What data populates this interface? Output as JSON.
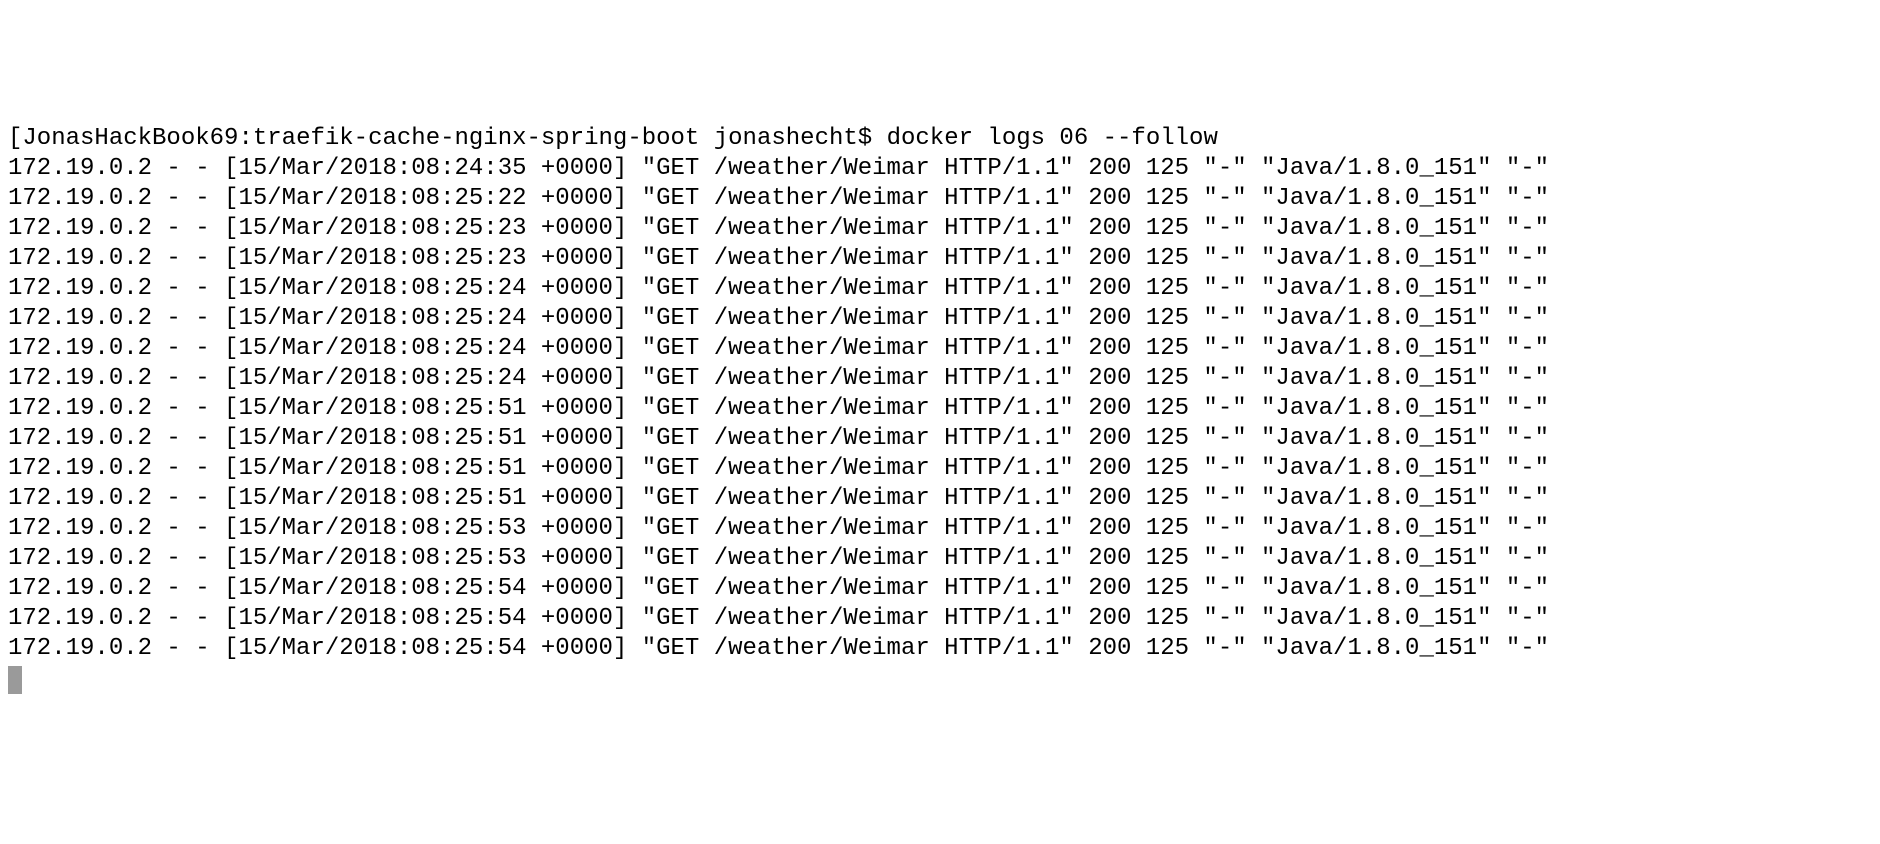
{
  "prompt": {
    "open_bracket": "[",
    "host": "JonasHackBook69",
    "sep1": ":",
    "path": "traefik-cache-nginx-spring-boot",
    "space": " ",
    "user": "jonashecht",
    "dollar": "$ ",
    "command": "docker logs 06 --follow"
  },
  "log_entries": [
    {
      "ip": "172.19.0.2",
      "dash1": " - - ",
      "ts": "[15/Mar/2018:08:24:35 +0000]",
      "req": " \"GET /weather/Weimar HTTP/1.1\" ",
      "status": "200",
      "size": " 125 ",
      "ref": "\"-\" ",
      "ua": "\"Java/1.8.0_151\" ",
      "tail": "\"-\""
    },
    {
      "ip": "172.19.0.2",
      "dash1": " - - ",
      "ts": "[15/Mar/2018:08:25:22 +0000]",
      "req": " \"GET /weather/Weimar HTTP/1.1\" ",
      "status": "200",
      "size": " 125 ",
      "ref": "\"-\" ",
      "ua": "\"Java/1.8.0_151\" ",
      "tail": "\"-\""
    },
    {
      "ip": "172.19.0.2",
      "dash1": " - - ",
      "ts": "[15/Mar/2018:08:25:23 +0000]",
      "req": " \"GET /weather/Weimar HTTP/1.1\" ",
      "status": "200",
      "size": " 125 ",
      "ref": "\"-\" ",
      "ua": "\"Java/1.8.0_151\" ",
      "tail": "\"-\""
    },
    {
      "ip": "172.19.0.2",
      "dash1": " - - ",
      "ts": "[15/Mar/2018:08:25:23 +0000]",
      "req": " \"GET /weather/Weimar HTTP/1.1\" ",
      "status": "200",
      "size": " 125 ",
      "ref": "\"-\" ",
      "ua": "\"Java/1.8.0_151\" ",
      "tail": "\"-\""
    },
    {
      "ip": "172.19.0.2",
      "dash1": " - - ",
      "ts": "[15/Mar/2018:08:25:24 +0000]",
      "req": " \"GET /weather/Weimar HTTP/1.1\" ",
      "status": "200",
      "size": " 125 ",
      "ref": "\"-\" ",
      "ua": "\"Java/1.8.0_151\" ",
      "tail": "\"-\""
    },
    {
      "ip": "172.19.0.2",
      "dash1": " - - ",
      "ts": "[15/Mar/2018:08:25:24 +0000]",
      "req": " \"GET /weather/Weimar HTTP/1.1\" ",
      "status": "200",
      "size": " 125 ",
      "ref": "\"-\" ",
      "ua": "\"Java/1.8.0_151\" ",
      "tail": "\"-\""
    },
    {
      "ip": "172.19.0.2",
      "dash1": " - - ",
      "ts": "[15/Mar/2018:08:25:24 +0000]",
      "req": " \"GET /weather/Weimar HTTP/1.1\" ",
      "status": "200",
      "size": " 125 ",
      "ref": "\"-\" ",
      "ua": "\"Java/1.8.0_151\" ",
      "tail": "\"-\""
    },
    {
      "ip": "172.19.0.2",
      "dash1": " - - ",
      "ts": "[15/Mar/2018:08:25:24 +0000]",
      "req": " \"GET /weather/Weimar HTTP/1.1\" ",
      "status": "200",
      "size": " 125 ",
      "ref": "\"-\" ",
      "ua": "\"Java/1.8.0_151\" ",
      "tail": "\"-\""
    },
    {
      "ip": "172.19.0.2",
      "dash1": " - - ",
      "ts": "[15/Mar/2018:08:25:51 +0000]",
      "req": " \"GET /weather/Weimar HTTP/1.1\" ",
      "status": "200",
      "size": " 125 ",
      "ref": "\"-\" ",
      "ua": "\"Java/1.8.0_151\" ",
      "tail": "\"-\""
    },
    {
      "ip": "172.19.0.2",
      "dash1": " - - ",
      "ts": "[15/Mar/2018:08:25:51 +0000]",
      "req": " \"GET /weather/Weimar HTTP/1.1\" ",
      "status": "200",
      "size": " 125 ",
      "ref": "\"-\" ",
      "ua": "\"Java/1.8.0_151\" ",
      "tail": "\"-\""
    },
    {
      "ip": "172.19.0.2",
      "dash1": " - - ",
      "ts": "[15/Mar/2018:08:25:51 +0000]",
      "req": " \"GET /weather/Weimar HTTP/1.1\" ",
      "status": "200",
      "size": " 125 ",
      "ref": "\"-\" ",
      "ua": "\"Java/1.8.0_151\" ",
      "tail": "\"-\""
    },
    {
      "ip": "172.19.0.2",
      "dash1": " - - ",
      "ts": "[15/Mar/2018:08:25:51 +0000]",
      "req": " \"GET /weather/Weimar HTTP/1.1\" ",
      "status": "200",
      "size": " 125 ",
      "ref": "\"-\" ",
      "ua": "\"Java/1.8.0_151\" ",
      "tail": "\"-\""
    },
    {
      "ip": "172.19.0.2",
      "dash1": " - - ",
      "ts": "[15/Mar/2018:08:25:53 +0000]",
      "req": " \"GET /weather/Weimar HTTP/1.1\" ",
      "status": "200",
      "size": " 125 ",
      "ref": "\"-\" ",
      "ua": "\"Java/1.8.0_151\" ",
      "tail": "\"-\""
    },
    {
      "ip": "172.19.0.2",
      "dash1": " - - ",
      "ts": "[15/Mar/2018:08:25:53 +0000]",
      "req": " \"GET /weather/Weimar HTTP/1.1\" ",
      "status": "200",
      "size": " 125 ",
      "ref": "\"-\" ",
      "ua": "\"Java/1.8.0_151\" ",
      "tail": "\"-\""
    },
    {
      "ip": "172.19.0.2",
      "dash1": " - - ",
      "ts": "[15/Mar/2018:08:25:54 +0000]",
      "req": " \"GET /weather/Weimar HTTP/1.1\" ",
      "status": "200",
      "size": " 125 ",
      "ref": "\"-\" ",
      "ua": "\"Java/1.8.0_151\" ",
      "tail": "\"-\""
    },
    {
      "ip": "172.19.0.2",
      "dash1": " - - ",
      "ts": "[15/Mar/2018:08:25:54 +0000]",
      "req": " \"GET /weather/Weimar HTTP/1.1\" ",
      "status": "200",
      "size": " 125 ",
      "ref": "\"-\" ",
      "ua": "\"Java/1.8.0_151\" ",
      "tail": "\"-\""
    },
    {
      "ip": "172.19.0.2",
      "dash1": " - - ",
      "ts": "[15/Mar/2018:08:25:54 +0000]",
      "req": " \"GET /weather/Weimar HTTP/1.1\" ",
      "status": "200",
      "size": " 125 ",
      "ref": "\"-\" ",
      "ua": "\"Java/1.8.0_151\" ",
      "tail": "\"-\""
    }
  ]
}
